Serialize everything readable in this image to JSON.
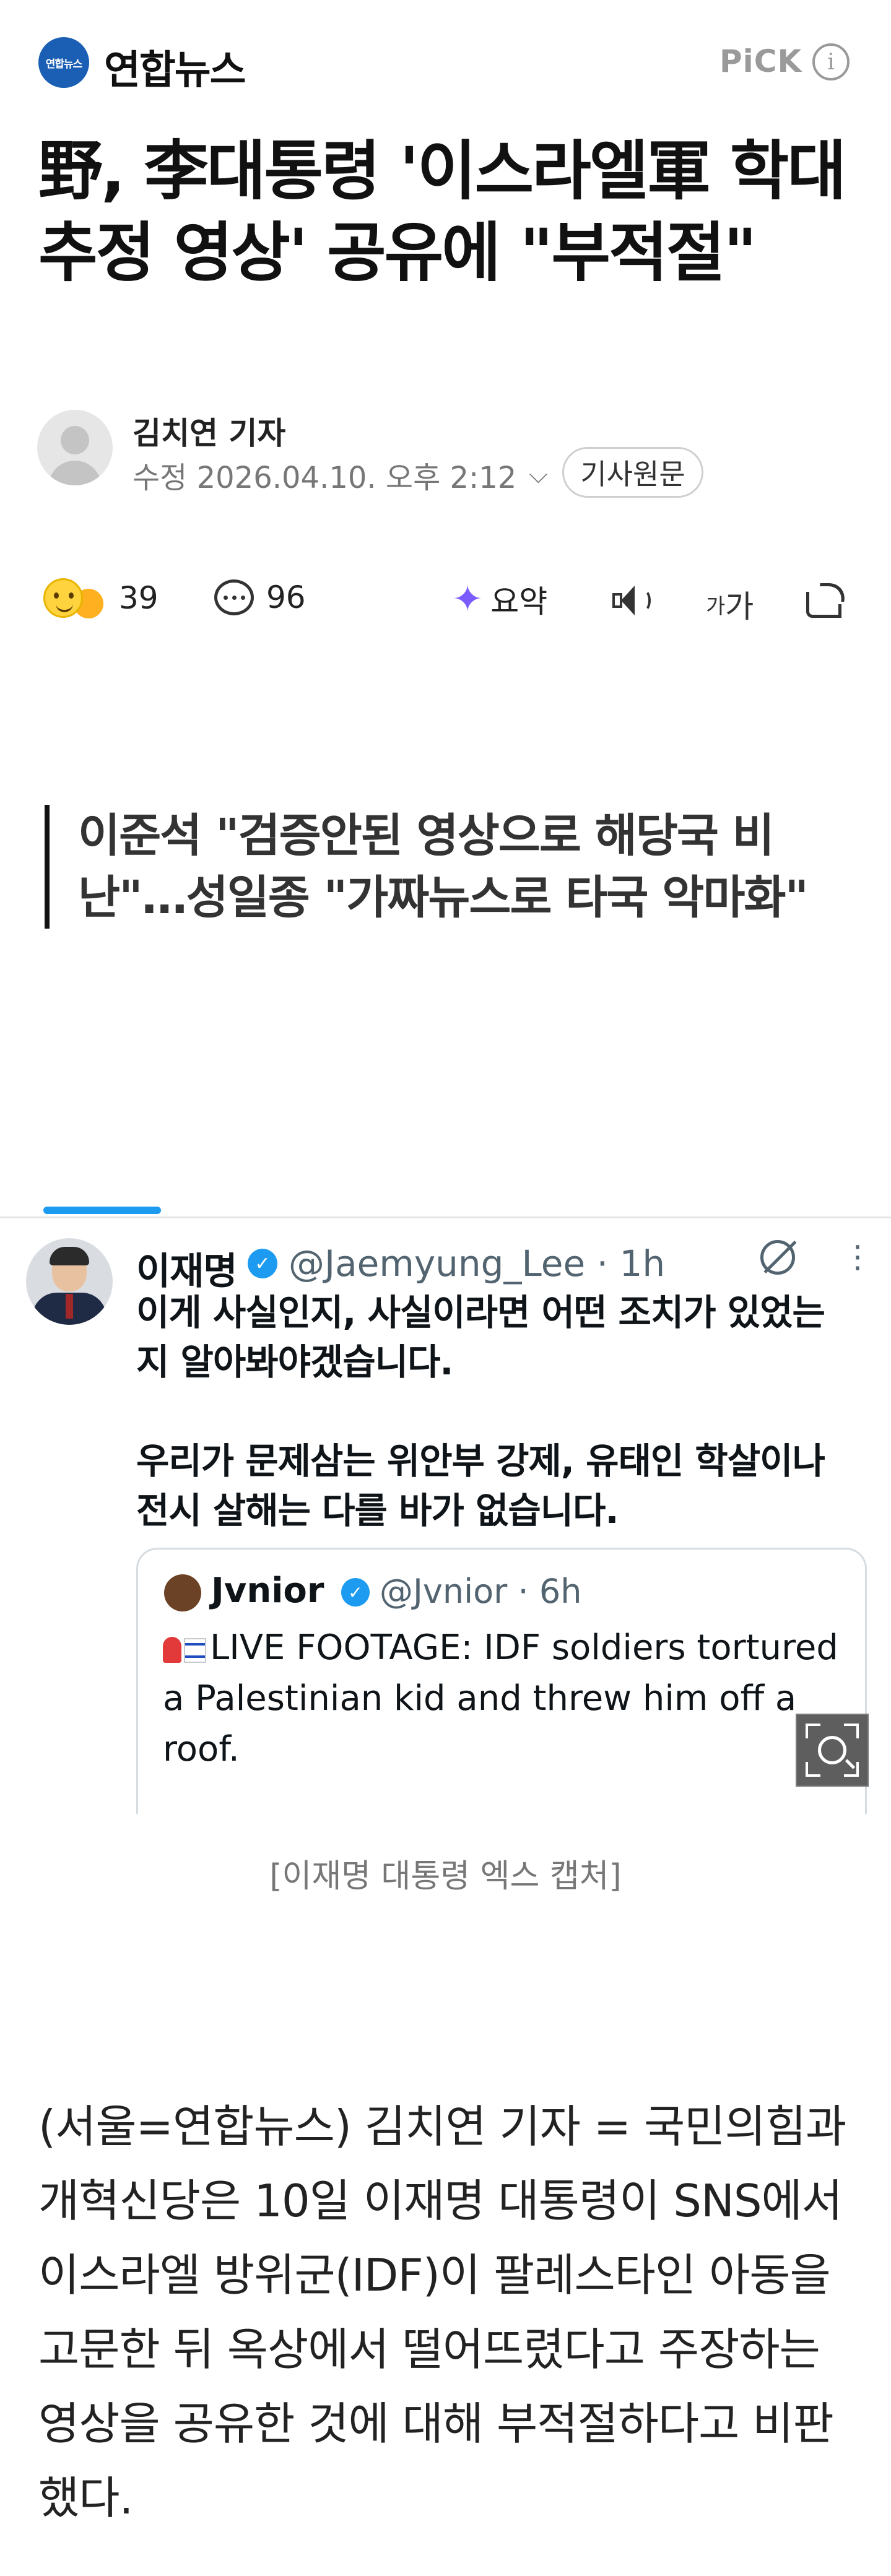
{
  "header": {
    "logo_mark": "연합뉴스",
    "logo_text": "연합뉴스",
    "pick_label": "PiCK",
    "info_icon": "info-icon"
  },
  "article": {
    "headline": "野, 李대통령 '이스라엘軍 학대 추정 영상' 공유에 \"부적절\"",
    "reporter": "김치연 기자",
    "meta": "수정 2026.04.10. 오후 2:12",
    "original_button": "기사원문",
    "subheadline": "이준석 \"검증안된 영상으로 해당국 비난\"…성일종 \"가짜뉴스로 타국 악마화\"",
    "caption": "[이재명 대통령 엑스 캡처]",
    "body": "(서울=연합뉴스) 김치연 기자 = 국민의힘과 개혁신당은 10일 이재명 대통령이 SNS에서 이스라엘 방위군(IDF)이 팔레스타인 아동을 고문한 뒤 옥상에서 떨어뜨렸다고 주장하는 영상을 공유한 것에 대해 부적절하다고 비판했다."
  },
  "actions": {
    "reactions_count": "39",
    "comments_count": "96",
    "summary_label": "요약",
    "fontsize_small": "가",
    "fontsize_large": "가"
  },
  "embedded_post": {
    "author": "이재명",
    "handle": "@Jaemyung_Lee · 1h",
    "text1": "이게 사실인지, 사실이라면 어떤 조치가 있었는지 알아봐야겠습니다.",
    "text2": "우리가 문제삼는 위안부 강제, 유태인 학살이나 전시 살해는 다를 바가 없습니다.",
    "quoted": {
      "author": "Jvnior",
      "handle": "@Jvnior · 6h",
      "text": "LIVE FOOTAGE: IDF soldiers tortured a Palestinian kid and threw him off a roof."
    }
  },
  "colors": {
    "brand_blue": "#1a5fb4",
    "twitter_blue": "#1d9bf0",
    "summary_purple": "#7b5cff"
  }
}
